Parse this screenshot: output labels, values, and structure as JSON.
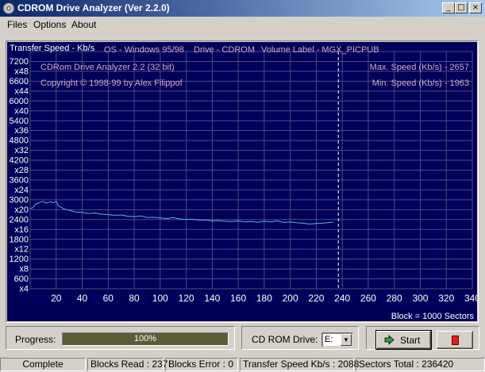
{
  "window": {
    "title": "CDROM Drive Analyzer (Ver 2.2.0)",
    "min_glyph": "_",
    "max_glyph": "□",
    "close_glyph": "×"
  },
  "menu": {
    "files": "Files",
    "options": "Options",
    "about": "About"
  },
  "chart_data": {
    "type": "line",
    "ylabel": "Transfer Speed - Kb/s",
    "info": {
      "os": "OS - Windows 95/98",
      "drive": "Drive - CDROM",
      "volume": "Volume Label - MGX_PICPUB"
    },
    "annotations": {
      "product": "CDRom Drive Analyzer 2.2 (32 bit)",
      "copyright": "Copyright © 1998-99 by Alex Filippof",
      "max_speed": "Max. Speed (Kb/s) - 2657",
      "min_speed": "Min.  Speed (Kb/s) - 1963"
    },
    "xlabel": "Block = 1000 Sectors",
    "xlim": [
      0,
      340
    ],
    "ylim": [
      0,
      7200
    ],
    "x_ticks": [
      "20",
      "40",
      "60",
      "80",
      "100",
      "120",
      "140",
      "160",
      "180",
      "200",
      "220",
      "240",
      "260",
      "280",
      "300",
      "320",
      "340"
    ],
    "y_ticks": [
      {
        "speed": "7200",
        "mult": ""
      },
      {
        "speed": "",
        "mult": "x48"
      },
      {
        "speed": "6600",
        "mult": ""
      },
      {
        "speed": "",
        "mult": "x44"
      },
      {
        "speed": "6000",
        "mult": ""
      },
      {
        "speed": "",
        "mult": "x40"
      },
      {
        "speed": "5400",
        "mult": ""
      },
      {
        "speed": "",
        "mult": "x36"
      },
      {
        "speed": "4800",
        "mult": ""
      },
      {
        "speed": "",
        "mult": "x32"
      },
      {
        "speed": "4200",
        "mult": ""
      },
      {
        "speed": "",
        "mult": "x28"
      },
      {
        "speed": "3600",
        "mult": ""
      },
      {
        "speed": "",
        "mult": "x24"
      },
      {
        "speed": "3000",
        "mult": ""
      },
      {
        "speed": "",
        "mult": "x20"
      },
      {
        "speed": "2400",
        "mult": ""
      },
      {
        "speed": "",
        "mult": "x16"
      },
      {
        "speed": "1800",
        "mult": ""
      },
      {
        "speed": "",
        "mult": "x12"
      },
      {
        "speed": "1200",
        "mult": ""
      },
      {
        "speed": "",
        "mult": "x8"
      },
      {
        "speed": "600",
        "mult": ""
      },
      {
        "speed": "",
        "mult": "x4"
      }
    ],
    "marker_x": 237,
    "grid": true,
    "colors": {
      "background": "#00005a",
      "grid": "#4a5080",
      "line": "#59b7d6",
      "text": "#d4a7c7",
      "label": "#ffffff",
      "marker": "#ffffff"
    },
    "series": [
      {
        "x": [
          0,
          2,
          4,
          6,
          8,
          10,
          12,
          14,
          16,
          18,
          20,
          22,
          24,
          26,
          28,
          30,
          35,
          40,
          45,
          50,
          55,
          60,
          65,
          70,
          75,
          80,
          85,
          90,
          95,
          100,
          105,
          110,
          115,
          120,
          125,
          130,
          135,
          140,
          145,
          150,
          155,
          160,
          165,
          170,
          175,
          180,
          185,
          190,
          195,
          200,
          205,
          210,
          215,
          220,
          225,
          230,
          233
        ],
        "y": [
          2430,
          2460,
          2560,
          2600,
          2630,
          2650,
          2600,
          2620,
          2640,
          2610,
          2657,
          2500,
          2470,
          2420,
          2400,
          2380,
          2330,
          2320,
          2280,
          2300,
          2260,
          2250,
          2230,
          2240,
          2200,
          2190,
          2210,
          2160,
          2170,
          2150,
          2130,
          2160,
          2120,
          2100,
          2110,
          2080,
          2090,
          2060,
          2070,
          2050,
          2040,
          2060,
          2030,
          2040,
          2020,
          2050,
          2030,
          2060,
          2010,
          2030,
          2000,
          1990,
          1963,
          1980,
          1990,
          2010,
          2020
        ]
      }
    ]
  },
  "controls": {
    "progress_label": "Progress:",
    "progress_value": 1.0,
    "progress_text": "100%",
    "drive_label": "CD ROM Drive:",
    "drive_value": "E:",
    "start_label": "Start"
  },
  "status": {
    "state": "Complete",
    "blocks_read": "Blocks Read : 237",
    "blocks_error": "Blocks Error : 0",
    "transfer_speed": "Transfer Speed Kb/s : 2088",
    "sectors_total": "Sectors Total : 236420"
  }
}
